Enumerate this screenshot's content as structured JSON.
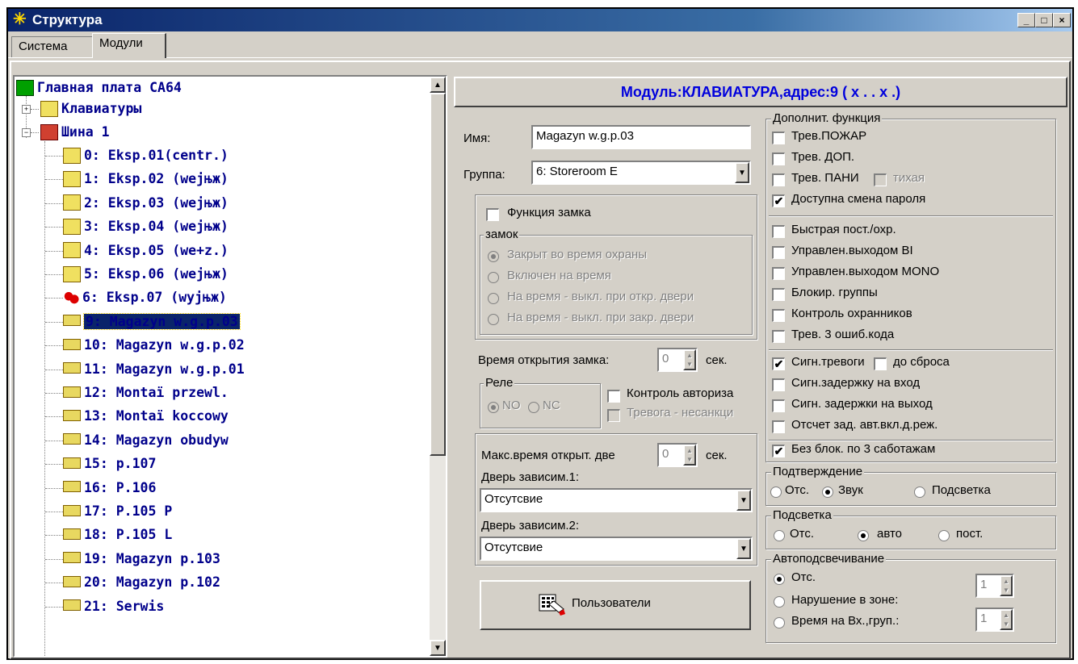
{
  "window": {
    "title": "Структура",
    "buttons": [
      "_",
      "□",
      "×"
    ]
  },
  "tabs": [
    {
      "label": "Система"
    },
    {
      "label": "Модули"
    }
  ],
  "tree": {
    "root": "Главная плата CA64",
    "keypads": "Клавиатуры",
    "bus": "Шина 1",
    "modules": [
      "0: Eksp.01(centr.)",
      "1: Eksp.02 (weјњж)",
      "2: Eksp.03 (weјњж)",
      "3: Eksp.04 (weјњж)",
      "4: Eksp.05 (we+z.)",
      "5: Eksp.06 (weјњж)",
      "6: Eksp.07 (wyјњж)",
      "9: Magazyn w.g.p.03",
      "10: Magazyn w.g.p.02",
      "11: Magazyn w.g.p.01",
      "12: Montaї przewl.",
      "13: Montaї koccowy",
      "14: Magazyn obudyw",
      "15: p.107",
      "16: P.106",
      "17: P.105  P",
      "18: P.105  L",
      "19: Magazyn p.103",
      "20: Magazyn p.102",
      "21: Serwis"
    ],
    "selected_index": 7
  },
  "module": {
    "header": "Модуль:КЛАВИАТУРА,адрес:9 ( x . . x .)",
    "name_label": "Имя:",
    "name_value": "Magazyn w.g.p.03",
    "group_label": "Группа:",
    "group_value": "6: Storeroom E",
    "lock_function": "Функция замка",
    "lock_group": "замок",
    "lock_options": [
      "Закрыт во время охраны",
      "Включен на время",
      "На время - выкл. при откр. двери",
      "На время - выкл. при закр. двери"
    ],
    "lock_time_label": "Время открытия замка:",
    "lock_time_value": "0",
    "sec_label": "сек.",
    "relay_group": "Реле",
    "relay_no": "NO",
    "relay_nc": "NC",
    "auth_control": "Контроль авториза",
    "unauth_alarm": "Тревога - несанкци",
    "max_door_label": "Макс.время открыт. две",
    "max_door_value": "0",
    "door_dep1_label": "Дверь зависим.1:",
    "door_dep1_value": "Отсутсвие",
    "door_dep2_label": "Дверь зависим.2:",
    "door_dep2_value": "Отсутсвие",
    "users_button": "Пользователи"
  },
  "extra": {
    "group_label": "Дополнит. функция",
    "fire": "Трев.ПОЖАР",
    "aux": "Трев. ДОП.",
    "panic": "Трев. ПАНИ",
    "silent": "тихая",
    "pwd_change": "Доступна смена пароля",
    "opts2": [
      "Быстрая пост./охр.",
      "Управлен.выходом BI",
      "Управлен.выходом MONO",
      "Блокир. группы",
      "Контроль охранников",
      "Трев. 3 ошиб.кода"
    ],
    "sig_alarm": "Сигн.тревоги",
    "until_reset": "до сброса",
    "opts3": [
      "Сигн.задержку на вход",
      "Сигн. задержки на выход",
      "Отсчет зад. авт.вкл.д.реж."
    ],
    "no_block": "Без блок. по 3 саботажам"
  },
  "confirm": {
    "label": "Подтверждение",
    "options": [
      "Отс.",
      "Звук",
      "Подсветка"
    ],
    "selected": 1
  },
  "backlight": {
    "label": "Подсветка",
    "options": [
      "Отс.",
      "авто",
      "пост."
    ],
    "selected": 1
  },
  "autolight": {
    "label": "Автоподсвечивание",
    "options": [
      "Отс.",
      "Нарушение в зоне:",
      "Время на Вх.,груп.:"
    ],
    "selected": 0,
    "zone_value": "1",
    "time_value": "1"
  }
}
